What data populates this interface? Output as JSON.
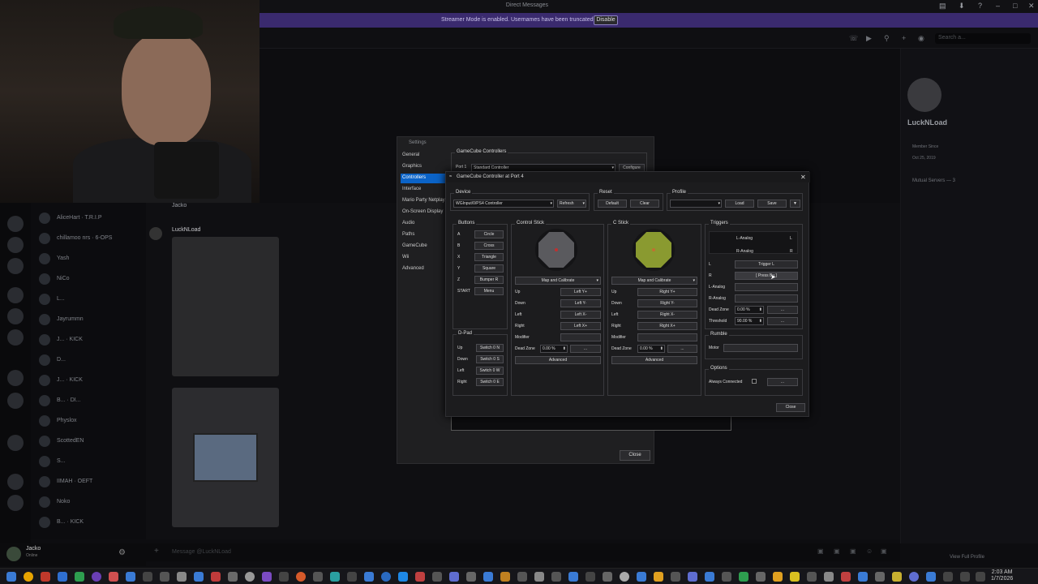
{
  "topbar": {
    "title": "Direct Messages"
  },
  "banner": {
    "text": "Streamer Mode is enabled. Usernames have been truncated.",
    "button": "Disable"
  },
  "search": {
    "placeholder": "Search a..."
  },
  "dm_list": [
    {
      "name": "AliceHart · T.R.I.P"
    },
    {
      "name": "chillamoo nrs · 6-OPS"
    },
    {
      "name": "Yash"
    },
    {
      "name": "NiCo"
    },
    {
      "name": "L..."
    },
    {
      "name": "Jayrummn"
    },
    {
      "name": "J... · KICK"
    },
    {
      "name": "D..."
    },
    {
      "name": "J... · KICK"
    },
    {
      "name": "B... · DI..."
    },
    {
      "name": "Physlox"
    },
    {
      "name": "ScottedEN"
    },
    {
      "name": "S..."
    },
    {
      "name": "IIMAH · OEFT"
    },
    {
      "name": "Noko"
    },
    {
      "name": "B... · KICK"
    }
  ],
  "chat": {
    "sender1": "Jacko",
    "sender2": "LuckNLoad",
    "composer_placeholder": "Message @LuckNLoad"
  },
  "profile": {
    "name": "LuckNLoad",
    "member_since_label": "Member Since",
    "member_since": "Oct 25, 2019",
    "mutual": "Mutual Servers — 3",
    "footer": "View Full Profile"
  },
  "user": {
    "name": "Jacko",
    "status": "Online"
  },
  "clock": {
    "time": "2:03 AM",
    "date": "1/7/2026"
  },
  "settings": {
    "title": "Settings",
    "nav": [
      "General",
      "Graphics",
      "Controllers",
      "Interface",
      "Mario Party Netplay",
      "On-Screen Display",
      "Audio",
      "Paths",
      "GameCube",
      "Wii",
      "Advanced"
    ],
    "selected": "Controllers",
    "gc_group": "GameCube Controllers",
    "port_label": "Port 1",
    "port_value": "Standard Controller",
    "configure": "Configure",
    "close": "Close"
  },
  "controller": {
    "title": "GameCube Controller at Port 4",
    "device": {
      "label": "Device",
      "value": "WGInput/0/PS4 Controller",
      "refresh": "Refresh"
    },
    "reset": {
      "label": "Reset",
      "default": "Default",
      "clear": "Clear"
    },
    "profile": {
      "label": "Profile",
      "load": "Load",
      "save": "Save"
    },
    "buttons": {
      "label": "Buttons",
      "rows": [
        [
          "A",
          "Circle"
        ],
        [
          "B",
          "Cross"
        ],
        [
          "X",
          "Triangle"
        ],
        [
          "Y",
          "Square"
        ],
        [
          "Z",
          "Bumper R"
        ],
        [
          "START",
          "Menu"
        ]
      ]
    },
    "dpad": {
      "label": "D-Pad",
      "rows": [
        [
          "Up",
          "Switch 0 N"
        ],
        [
          "Down",
          "Switch 0 S"
        ],
        [
          "Left",
          "Switch 0 W"
        ],
        [
          "Right",
          "Switch 0 E"
        ]
      ]
    },
    "control_stick": {
      "label": "Control Stick",
      "map": "Map and Calibrate",
      "rows": [
        [
          "Up",
          "Left Y+"
        ],
        [
          "Down",
          "Left Y-"
        ],
        [
          "Left",
          "Left X-"
        ],
        [
          "Right",
          "Left X+"
        ],
        [
          "Modifier",
          ""
        ]
      ],
      "dead_zone_label": "Dead Zone",
      "dead_zone": "0.00 %",
      "more": "...",
      "advanced": "Advanced"
    },
    "c_stick": {
      "label": "C Stick",
      "map": "Map and Calibrate",
      "rows": [
        [
          "Up",
          "Right Y+"
        ],
        [
          "Down",
          "Right Y-"
        ],
        [
          "Left",
          "Right X-"
        ],
        [
          "Right",
          "Right X+"
        ],
        [
          "Modifier",
          ""
        ]
      ],
      "dead_zone_label": "Dead Zone",
      "dead_zone": "0.00 %",
      "more": "...",
      "advanced": "Advanced"
    },
    "triggers": {
      "label": "Triggers",
      "l_analog": "L-Analog",
      "l_key": "L",
      "r_analog": "R-Analog",
      "r_key": "R",
      "rows": [
        [
          "L",
          "Trigger L"
        ],
        [
          "R",
          "[ Press Bu ]"
        ],
        [
          "L-Analog",
          ""
        ],
        [
          "R-Analog",
          ""
        ]
      ],
      "dead_zone_label": "Dead Zone",
      "dead_zone": "0.00 %",
      "threshold_label": "Threshold",
      "threshold": "90.00 %",
      "more": "..."
    },
    "rumble": {
      "label": "Rumble",
      "motor": "Motor"
    },
    "options": {
      "label": "Options",
      "always_connected": "Always Connected",
      "more": "..."
    },
    "close": "Close"
  }
}
